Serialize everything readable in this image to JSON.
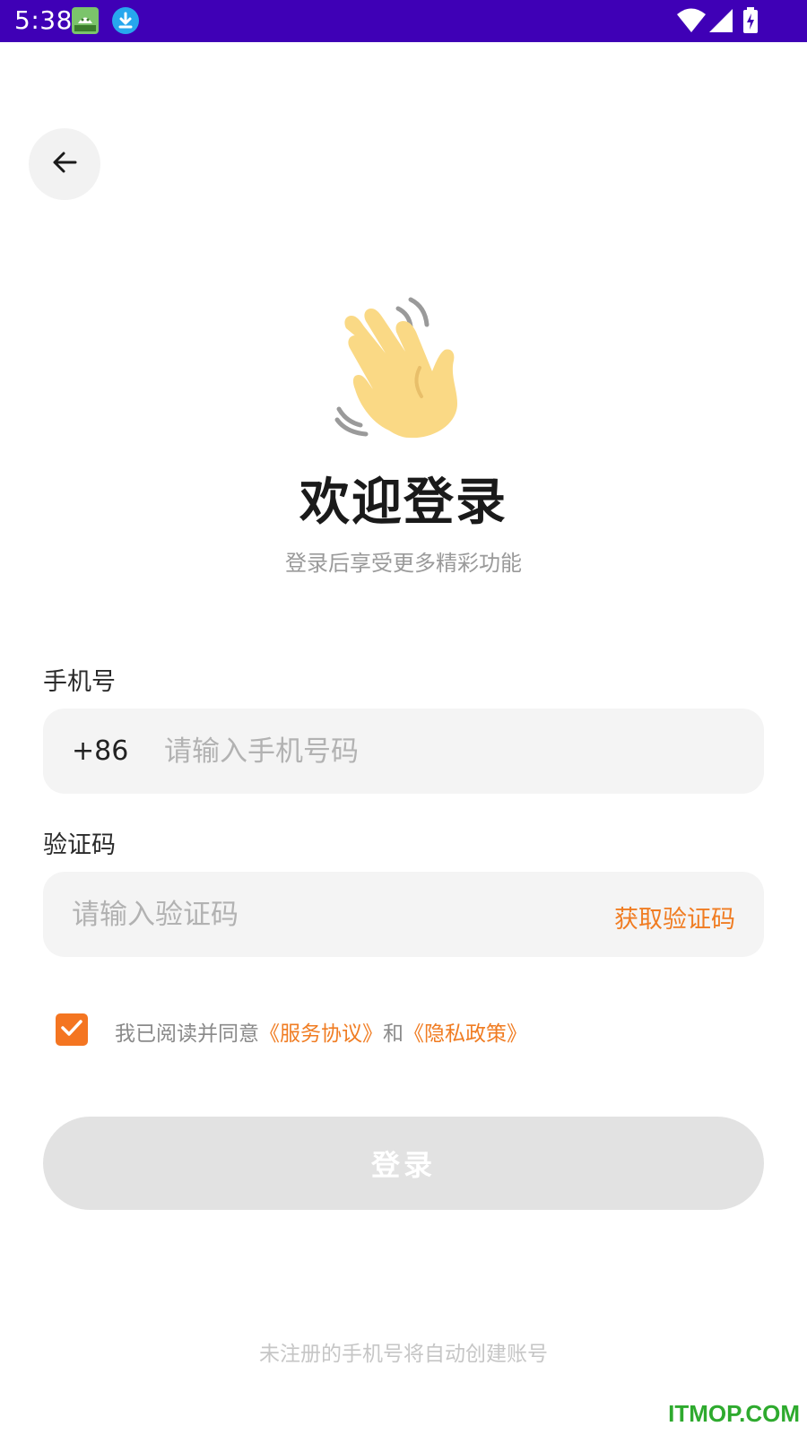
{
  "status_bar": {
    "time": "5:38",
    "background_color": "#3f00b6",
    "icons": [
      "android-notification-icon",
      "download-icon",
      "wifi-icon",
      "cellular-signal-icon",
      "battery-charging-icon"
    ]
  },
  "header": {
    "back_icon": "arrow-left-icon"
  },
  "hero": {
    "icon": "waving-hand-icon",
    "title": "欢迎登录",
    "subtitle": "登录后享受更多精彩功能"
  },
  "form": {
    "phone": {
      "label": "手机号",
      "country_code": "+86",
      "value": "",
      "placeholder": "请输入手机号码"
    },
    "code": {
      "label": "验证码",
      "value": "",
      "placeholder": "请输入验证码",
      "get_code_label": "获取验证码"
    }
  },
  "agreement": {
    "checked": true,
    "prefix": "我已阅读并同意",
    "terms_link": "《服务协议》",
    "conjunction": "和",
    "privacy_link": "《隐私政策》"
  },
  "login_button": {
    "label": "登录",
    "enabled": false
  },
  "footer_note": "未注册的手机号将自动创建账号",
  "watermark": "ITMOP.COM",
  "colors": {
    "accent": "#f07c22",
    "checkbox": "#f47521",
    "input_bg": "#f4f4f4",
    "button_disabled": "#e2e2e2"
  }
}
